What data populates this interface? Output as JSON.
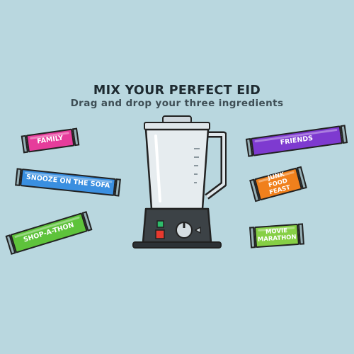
{
  "header": {
    "title": "MIX YOUR PERFECT EID",
    "subtitle": "Drag and drop your three ingredients"
  },
  "ingredients": {
    "family": {
      "label": "FAMILY",
      "color": "#e63c9b"
    },
    "snooze": {
      "label": "SNOOZE ON THE SOFA",
      "color": "#3a8fe0"
    },
    "shop": {
      "label": "SHOP-A-THON",
      "color": "#5ec33b"
    },
    "friends": {
      "label": "FRIENDS",
      "color": "#7e3ad0"
    },
    "junk": {
      "label": "JUNK FOOD FEAST",
      "color": "#f0801c"
    },
    "movie": {
      "label": "MOVIE MARATHON",
      "color": "#86cf45"
    }
  },
  "blender": {
    "base_color": "#3c4246",
    "go_button_color": "#2ebd6b",
    "stop_button_color": "#e8392e"
  }
}
